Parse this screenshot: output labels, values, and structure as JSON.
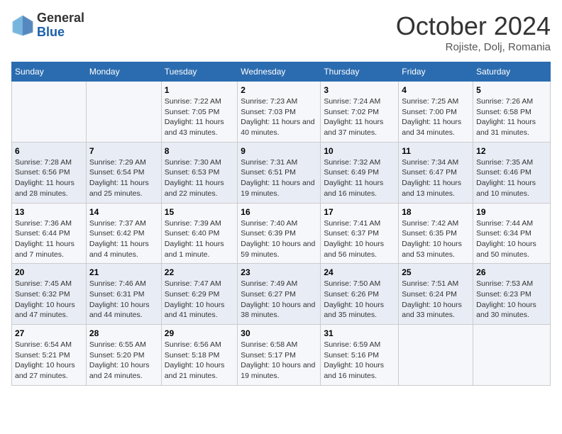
{
  "logo": {
    "general": "General",
    "blue": "Blue"
  },
  "title": "October 2024",
  "location": "Rojiste, Dolj, Romania",
  "header_days": [
    "Sunday",
    "Monday",
    "Tuesday",
    "Wednesday",
    "Thursday",
    "Friday",
    "Saturday"
  ],
  "weeks": [
    [
      {
        "day": "",
        "info": ""
      },
      {
        "day": "",
        "info": ""
      },
      {
        "day": "1",
        "info": "Sunrise: 7:22 AM\nSunset: 7:05 PM\nDaylight: 11 hours and 43 minutes."
      },
      {
        "day": "2",
        "info": "Sunrise: 7:23 AM\nSunset: 7:03 PM\nDaylight: 11 hours and 40 minutes."
      },
      {
        "day": "3",
        "info": "Sunrise: 7:24 AM\nSunset: 7:02 PM\nDaylight: 11 hours and 37 minutes."
      },
      {
        "day": "4",
        "info": "Sunrise: 7:25 AM\nSunset: 7:00 PM\nDaylight: 11 hours and 34 minutes."
      },
      {
        "day": "5",
        "info": "Sunrise: 7:26 AM\nSunset: 6:58 PM\nDaylight: 11 hours and 31 minutes."
      }
    ],
    [
      {
        "day": "6",
        "info": "Sunrise: 7:28 AM\nSunset: 6:56 PM\nDaylight: 11 hours and 28 minutes."
      },
      {
        "day": "7",
        "info": "Sunrise: 7:29 AM\nSunset: 6:54 PM\nDaylight: 11 hours and 25 minutes."
      },
      {
        "day": "8",
        "info": "Sunrise: 7:30 AM\nSunset: 6:53 PM\nDaylight: 11 hours and 22 minutes."
      },
      {
        "day": "9",
        "info": "Sunrise: 7:31 AM\nSunset: 6:51 PM\nDaylight: 11 hours and 19 minutes."
      },
      {
        "day": "10",
        "info": "Sunrise: 7:32 AM\nSunset: 6:49 PM\nDaylight: 11 hours and 16 minutes."
      },
      {
        "day": "11",
        "info": "Sunrise: 7:34 AM\nSunset: 6:47 PM\nDaylight: 11 hours and 13 minutes."
      },
      {
        "day": "12",
        "info": "Sunrise: 7:35 AM\nSunset: 6:46 PM\nDaylight: 11 hours and 10 minutes."
      }
    ],
    [
      {
        "day": "13",
        "info": "Sunrise: 7:36 AM\nSunset: 6:44 PM\nDaylight: 11 hours and 7 minutes."
      },
      {
        "day": "14",
        "info": "Sunrise: 7:37 AM\nSunset: 6:42 PM\nDaylight: 11 hours and 4 minutes."
      },
      {
        "day": "15",
        "info": "Sunrise: 7:39 AM\nSunset: 6:40 PM\nDaylight: 11 hours and 1 minute."
      },
      {
        "day": "16",
        "info": "Sunrise: 7:40 AM\nSunset: 6:39 PM\nDaylight: 10 hours and 59 minutes."
      },
      {
        "day": "17",
        "info": "Sunrise: 7:41 AM\nSunset: 6:37 PM\nDaylight: 10 hours and 56 minutes."
      },
      {
        "day": "18",
        "info": "Sunrise: 7:42 AM\nSunset: 6:35 PM\nDaylight: 10 hours and 53 minutes."
      },
      {
        "day": "19",
        "info": "Sunrise: 7:44 AM\nSunset: 6:34 PM\nDaylight: 10 hours and 50 minutes."
      }
    ],
    [
      {
        "day": "20",
        "info": "Sunrise: 7:45 AM\nSunset: 6:32 PM\nDaylight: 10 hours and 47 minutes."
      },
      {
        "day": "21",
        "info": "Sunrise: 7:46 AM\nSunset: 6:31 PM\nDaylight: 10 hours and 44 minutes."
      },
      {
        "day": "22",
        "info": "Sunrise: 7:47 AM\nSunset: 6:29 PM\nDaylight: 10 hours and 41 minutes."
      },
      {
        "day": "23",
        "info": "Sunrise: 7:49 AM\nSunset: 6:27 PM\nDaylight: 10 hours and 38 minutes."
      },
      {
        "day": "24",
        "info": "Sunrise: 7:50 AM\nSunset: 6:26 PM\nDaylight: 10 hours and 35 minutes."
      },
      {
        "day": "25",
        "info": "Sunrise: 7:51 AM\nSunset: 6:24 PM\nDaylight: 10 hours and 33 minutes."
      },
      {
        "day": "26",
        "info": "Sunrise: 7:53 AM\nSunset: 6:23 PM\nDaylight: 10 hours and 30 minutes."
      }
    ],
    [
      {
        "day": "27",
        "info": "Sunrise: 6:54 AM\nSunset: 5:21 PM\nDaylight: 10 hours and 27 minutes."
      },
      {
        "day": "28",
        "info": "Sunrise: 6:55 AM\nSunset: 5:20 PM\nDaylight: 10 hours and 24 minutes."
      },
      {
        "day": "29",
        "info": "Sunrise: 6:56 AM\nSunset: 5:18 PM\nDaylight: 10 hours and 21 minutes."
      },
      {
        "day": "30",
        "info": "Sunrise: 6:58 AM\nSunset: 5:17 PM\nDaylight: 10 hours and 19 minutes."
      },
      {
        "day": "31",
        "info": "Sunrise: 6:59 AM\nSunset: 5:16 PM\nDaylight: 10 hours and 16 minutes."
      },
      {
        "day": "",
        "info": ""
      },
      {
        "day": "",
        "info": ""
      }
    ]
  ]
}
